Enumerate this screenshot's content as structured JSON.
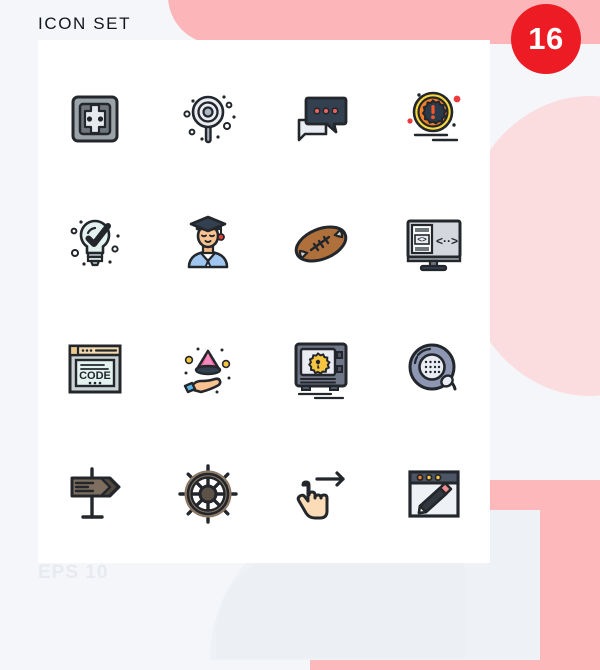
{
  "header": {
    "title": "ICON SET",
    "badge_count": "16"
  },
  "footer": {
    "label": "EPS 10"
  },
  "theme": {
    "background": "#f4f6f9",
    "card": "#ffffff",
    "accent_pink": "#fcb6b9",
    "badge_red": "#ed1c24",
    "title_color": "#13161c",
    "footer_color": "#e7eaef"
  },
  "grid": {
    "columns": 4,
    "rows": 4,
    "icons": [
      {
        "index": 1,
        "name": "power-socket-icon",
        "label": "Power socket"
      },
      {
        "index": 2,
        "name": "lollipop-icon",
        "label": "Lollipop"
      },
      {
        "index": 3,
        "name": "chat-bubbles-icon",
        "label": "Chat messages"
      },
      {
        "index": 4,
        "name": "alert-badge-icon",
        "label": "Alert badge"
      },
      {
        "index": 5,
        "name": "lightbulb-check-icon",
        "label": "Idea approved"
      },
      {
        "index": 6,
        "name": "graduate-student-icon",
        "label": "Graduate student"
      },
      {
        "index": 7,
        "name": "football-icon",
        "label": "American football"
      },
      {
        "index": 8,
        "name": "code-monitor-icon",
        "label": "Code monitor"
      },
      {
        "index": 9,
        "name": "code-browser-icon",
        "label": "CODE browser window"
      },
      {
        "index": 10,
        "name": "hand-hologram-icon",
        "label": "Hand hologram"
      },
      {
        "index": 11,
        "name": "safe-vault-icon",
        "label": "Safe vault"
      },
      {
        "index": 12,
        "name": "strainer-pan-icon",
        "label": "Strainer pan"
      },
      {
        "index": 13,
        "name": "signpost-icon",
        "label": "Direction signpost"
      },
      {
        "index": 14,
        "name": "ship-wheel-icon",
        "label": "Ship wheel"
      },
      {
        "index": 15,
        "name": "swipe-right-icon",
        "label": "Swipe right gesture"
      },
      {
        "index": 16,
        "name": "edit-window-icon",
        "label": "Edit browser window"
      }
    ],
    "icon_text": {
      "code_label": "CODE"
    }
  }
}
